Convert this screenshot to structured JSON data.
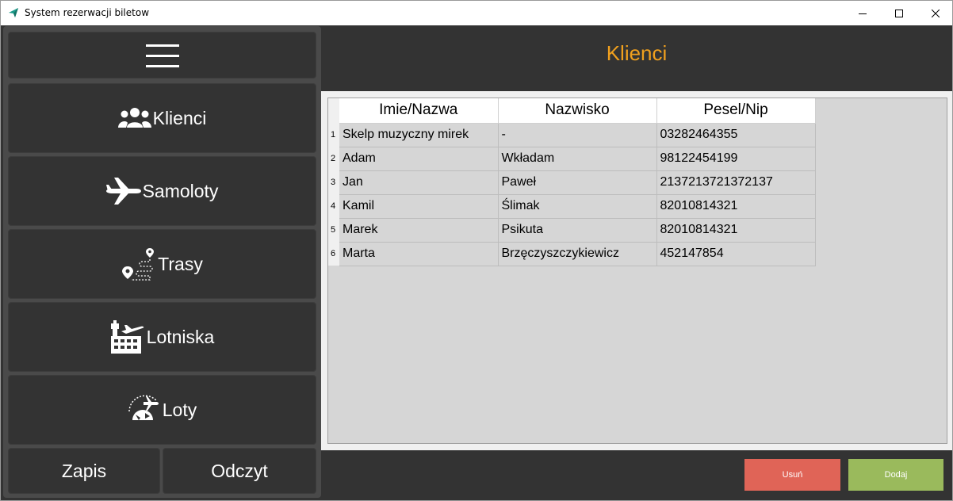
{
  "window": {
    "title": "System rezerwacji biletow"
  },
  "colors": {
    "accent": "#f0a01e",
    "background": "#333333",
    "delete": "#e06457",
    "add": "#9aba5c"
  },
  "sidebar": {
    "menu_icon": "hamburger-icon",
    "items": [
      {
        "label": "Klienci",
        "icon": "users-icon"
      },
      {
        "label": "Samoloty",
        "icon": "airplane-icon"
      },
      {
        "label": "Trasy",
        "icon": "route-icon"
      },
      {
        "label": "Lotniska",
        "icon": "airport-icon"
      },
      {
        "label": "Loty",
        "icon": "flight-icon"
      }
    ],
    "save_label": "Zapis",
    "load_label": "Odczyt"
  },
  "main": {
    "title": "Klienci",
    "table": {
      "columns": [
        "Imie/Nazwa",
        "Nazwisko",
        "Pesel/Nip"
      ],
      "rows": [
        {
          "num": "1",
          "name": "Skelp muzyczny mirek",
          "surname": "-",
          "id": "03282464355"
        },
        {
          "num": "2",
          "name": "Adam",
          "surname": "Wkładam",
          "id": "98122454199"
        },
        {
          "num": "3",
          "name": "Jan",
          "surname": "Paweł",
          "id": "2137213721372137"
        },
        {
          "num": "4",
          "name": "Kamil",
          "surname": "Ślimak",
          "id": "82010814321"
        },
        {
          "num": "5",
          "name": "Marek",
          "surname": "Psikuta",
          "id": "82010814321"
        },
        {
          "num": "6",
          "name": "Marta",
          "surname": "Brzęczyszczykiewicz",
          "id": "452147854"
        }
      ]
    },
    "delete_label": "Usuń",
    "add_label": "Dodaj"
  }
}
